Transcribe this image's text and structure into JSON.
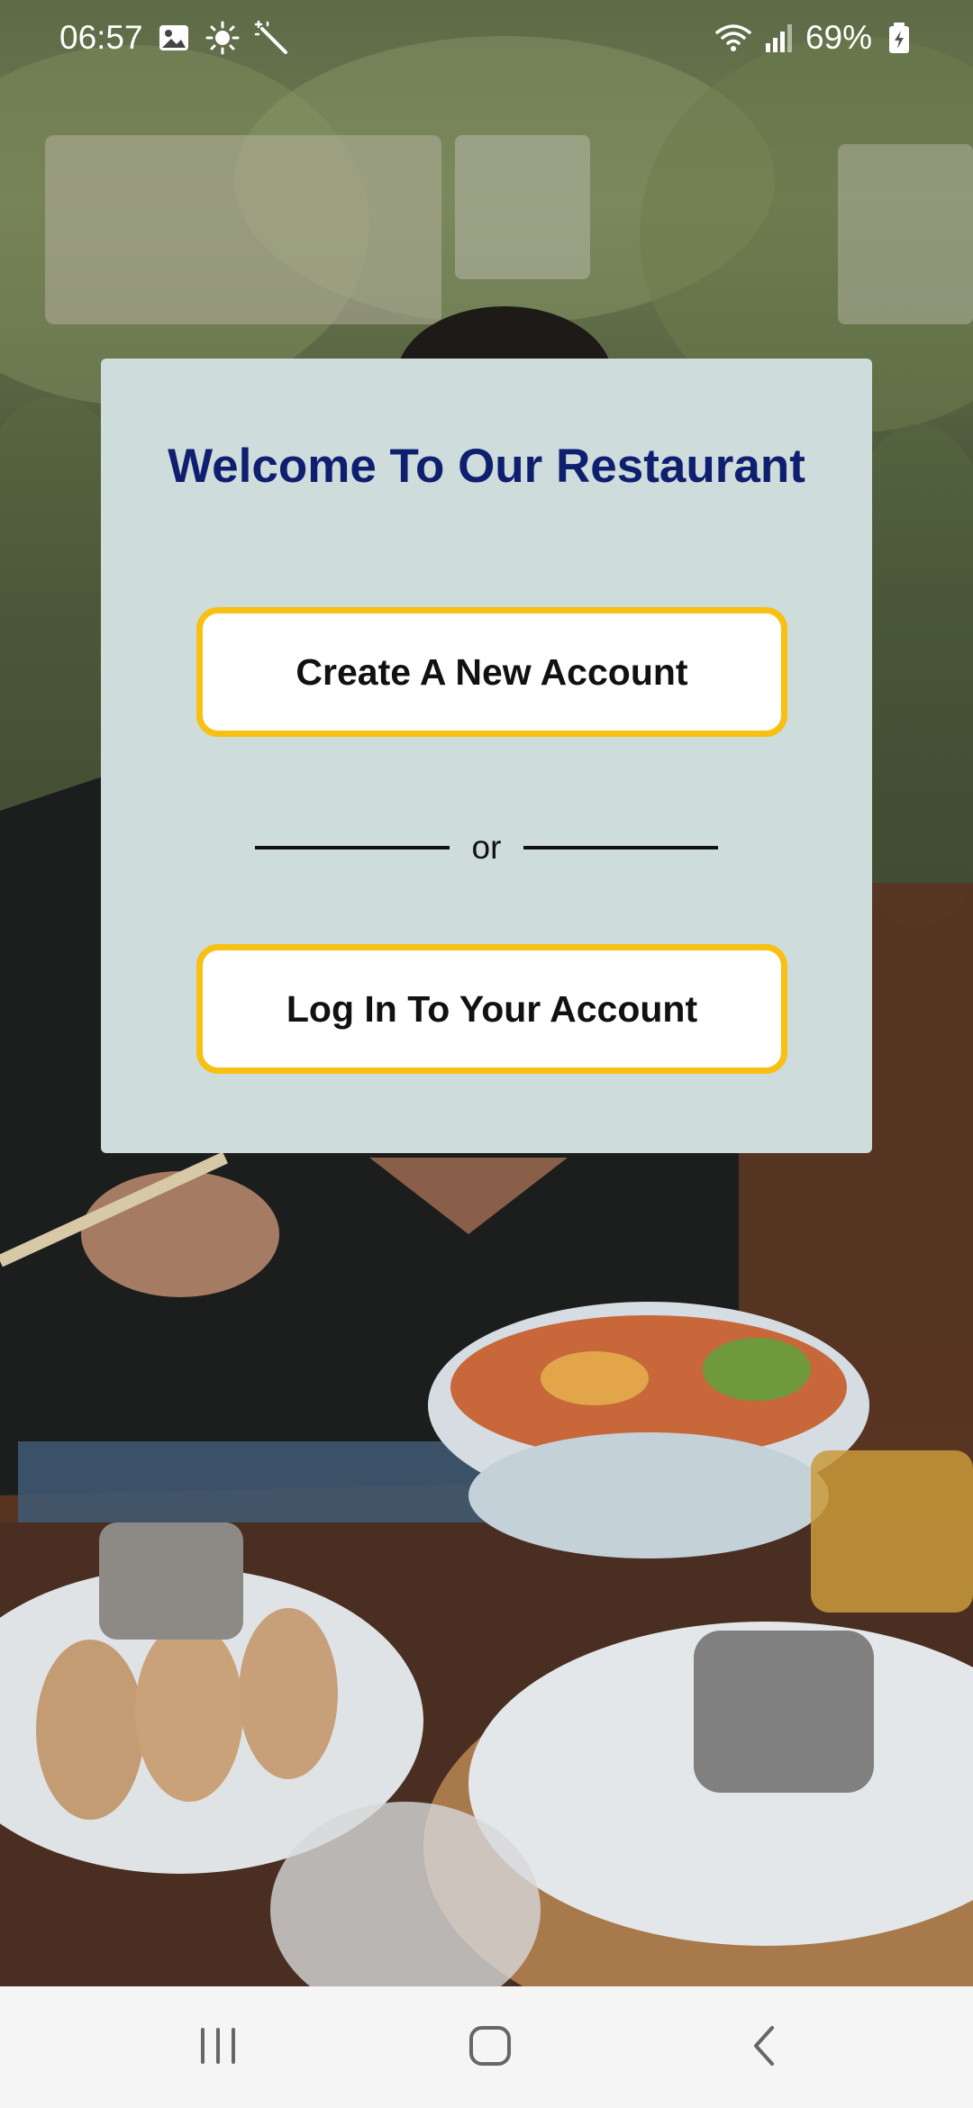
{
  "status_bar": {
    "time": "06:57",
    "battery_percent": "69%",
    "icons_left": [
      "gallery-icon",
      "brightness-icon",
      "magic-wand-icon"
    ],
    "icons_right": [
      "wifi-icon",
      "signal-icon",
      "battery-icon"
    ]
  },
  "card": {
    "title": "Welcome To Our Restaurant",
    "create_account_label": "Create A New Account",
    "divider_text": "or",
    "login_label": "Log In To Your Account"
  },
  "colors": {
    "card_background": "#cfdcdc",
    "title_color": "#0f1f6f",
    "button_border": "#f7c012",
    "button_background": "#ffffff",
    "nav_background": "#f5f5f5"
  },
  "nav_bar": {
    "icons": [
      "recent-apps-icon",
      "home-icon",
      "back-icon"
    ]
  }
}
